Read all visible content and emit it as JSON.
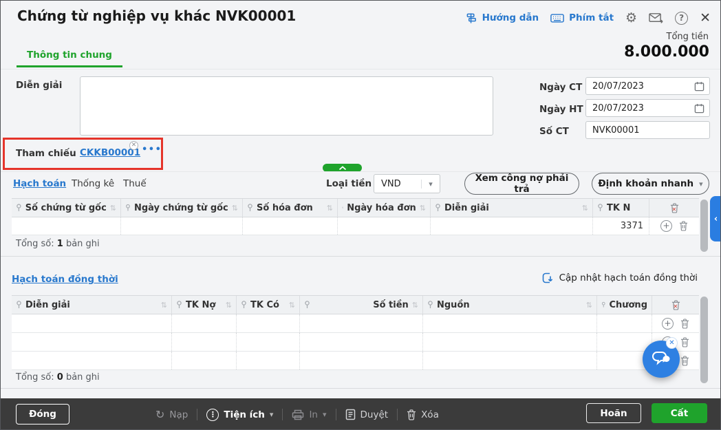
{
  "header": {
    "title": "Chứng từ nghiệp vụ khác NVK00001",
    "guide": "Hướng dẫn",
    "shortcuts": "Phím tắt",
    "total_label": "Tổng tiền",
    "total_value": "8.000.000"
  },
  "tabs": {
    "general": "Thông tin chung"
  },
  "form": {
    "description_label": "Diễn giải",
    "description_value": "",
    "reference_label": "Tham chiếu",
    "reference_value": "CKKB00001",
    "date_ct_label": "Ngày CT",
    "date_ct_value": "20/07/2023",
    "date_ht_label": "Ngày HT",
    "date_ht_value": "20/07/2023",
    "doc_no_label": "Số CT",
    "doc_no_value": "NVK00001"
  },
  "detail": {
    "tabs": [
      "Hạch toán",
      "Thống kê",
      "Thuế"
    ],
    "currency_label": "Loại tiền",
    "currency_value": "VND",
    "view_payables": "Xem công nợ phải trả",
    "quick_posting": "Định khoản nhanh"
  },
  "table1": {
    "columns": [
      "Số chứng từ gốc",
      "Ngày chứng từ gốc",
      "Số hóa đơn",
      "Ngày hóa đơn",
      "Diễn giải",
      "TK N"
    ],
    "rows": [
      {
        "tk_no": "3371"
      }
    ],
    "total_prefix": "Tổng số:",
    "total_count": "1",
    "total_suffix": "bản ghi"
  },
  "simultaneous": {
    "title": "Hạch toán đồng thời",
    "update": "Cập nhật hạch toán đồng thời"
  },
  "table2": {
    "columns": [
      "Diễn giải",
      "TK Nợ",
      "TK Có",
      "Số tiền",
      "Nguồn",
      "Chương"
    ],
    "total_prefix": "Tổng số:",
    "total_count": "0",
    "total_suffix": "bản ghi"
  },
  "footer": {
    "close": "Đóng",
    "reload": "Nạp",
    "utilities": "Tiện ích",
    "print": "In",
    "approve": "Duyệt",
    "delete": "Xóa",
    "postpone": "Hoãn",
    "save": "Cất"
  },
  "colors": {
    "green": "#1fa32c",
    "blue_link": "#2878cd",
    "annotation_red": "#e5342a",
    "fab_blue": "#2e80e2",
    "footer_bg": "#3b3b3b"
  }
}
